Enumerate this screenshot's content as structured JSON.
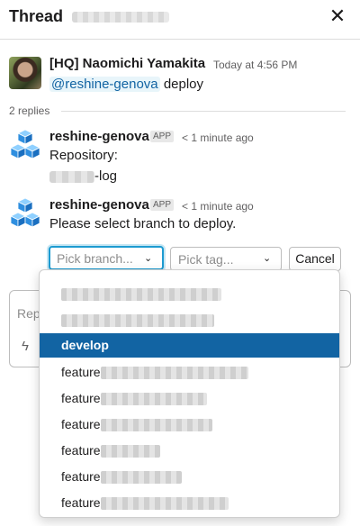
{
  "header": {
    "title": "Thread",
    "close_icon": "close-icon"
  },
  "parent_message": {
    "author": "[HQ] Naomichi Yamakita",
    "timestamp": "Today at 4:56 PM",
    "mention": "@reshine-genova",
    "text": "deploy"
  },
  "replies_label": "2 replies",
  "replies": [
    {
      "author": "reshine-genova",
      "badge": "APP",
      "timestamp": "< 1 minute ago",
      "line1": "Repository:",
      "line2_suffix": "-log"
    },
    {
      "author": "reshine-genova",
      "badge": "APP",
      "timestamp": "< 1 minute ago",
      "text": "Please select branch to deploy."
    }
  ],
  "selects": {
    "branch_placeholder": "Pick branch...",
    "tag_placeholder": "Pick tag...",
    "cancel_label": "Cancel"
  },
  "composer": {
    "placeholder": "Rep",
    "bolt_icon": "lightning-icon"
  },
  "menu": {
    "items": [
      {
        "label": ""
      },
      {
        "label": ""
      },
      {
        "label": "develop",
        "selected": true
      },
      {
        "label": "feature"
      },
      {
        "label": "feature"
      },
      {
        "label": "feature"
      },
      {
        "label": "feature"
      },
      {
        "label": "feature"
      },
      {
        "label": "feature"
      }
    ]
  },
  "colors": {
    "accent": "#1264a3",
    "focus": "#1d9bd1",
    "mention_bg": "#e8f5fa"
  }
}
